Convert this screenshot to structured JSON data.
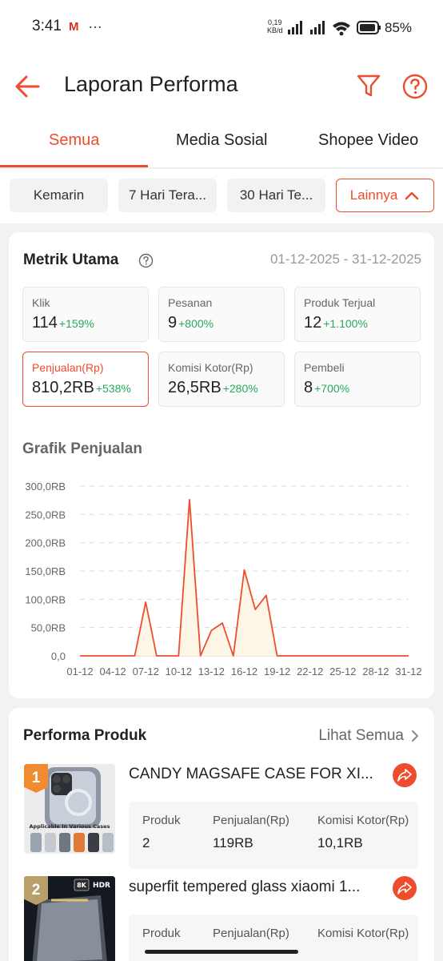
{
  "status_bar": {
    "time": "3:41",
    "gmail_icon": "gmail-icon",
    "more": "…",
    "speed_value": "0,19",
    "speed_unit": "KB/d",
    "battery_pct": "85%"
  },
  "header": {
    "title": "Laporan Performa",
    "back_icon": "back-arrow-icon",
    "filter_icon": "filter-icon",
    "help_icon": "help-icon",
    "accent": "#ee4d2d"
  },
  "tabs": [
    {
      "label": "Semua",
      "active": true
    },
    {
      "label": "Media Sosial",
      "active": false
    },
    {
      "label": "Shopee Video",
      "active": false
    }
  ],
  "date_chips": [
    {
      "label": "Kemarin"
    },
    {
      "label": "7 Hari Tera..."
    },
    {
      "label": "30 Hari Te..."
    },
    {
      "label": "Lainnya",
      "active": true
    }
  ],
  "metrics": {
    "title": "Metrik Utama",
    "date_range": "01-12-2025 - 31-12-2025",
    "items": [
      {
        "label": "Klik",
        "value": "114",
        "change": "+159%"
      },
      {
        "label": "Pesanan",
        "value": "9",
        "change": "+800%"
      },
      {
        "label": "Produk Terjual",
        "value": "12",
        "change": "+1.100%"
      },
      {
        "label": "Penjualan(Rp)",
        "value": "810,2RB",
        "change": "+538%",
        "active": true
      },
      {
        "label": "Komisi Kotor(Rp)",
        "value": "26,5RB",
        "change": "+280%"
      },
      {
        "label": "Pembeli",
        "value": "8",
        "change": "+700%"
      }
    ]
  },
  "chart_title": "Grafik Penjualan",
  "chart_data": {
    "type": "area",
    "title": "Grafik Penjualan",
    "xlabel": "",
    "ylabel": "",
    "x": [
      "01-12",
      "02-12",
      "03-12",
      "04-12",
      "05-12",
      "06-12",
      "07-12",
      "08-12",
      "09-12",
      "10-12",
      "11-12",
      "12-12",
      "13-12",
      "14-12",
      "15-12",
      "16-12",
      "17-12",
      "18-12",
      "19-12",
      "20-12",
      "21-12",
      "22-12",
      "23-12",
      "24-12",
      "25-12",
      "26-12",
      "27-12",
      "28-12",
      "29-12",
      "30-12",
      "31-12"
    ],
    "x_tick_labels": [
      "01-12",
      "04-12",
      "07-12",
      "10-12",
      "13-12",
      "16-12",
      "19-12",
      "22-12",
      "25-12",
      "28-12",
      "31-12"
    ],
    "y_tick_labels": [
      "0,0",
      "50,0RB",
      "100,0RB",
      "150,0RB",
      "200,0RB",
      "250,0RB",
      "300,0RB"
    ],
    "ylim": [
      0,
      300000
    ],
    "series": [
      {
        "values": [
          0,
          0,
          0,
          0,
          0,
          0,
          95000,
          0,
          0,
          0,
          276000,
          0,
          45000,
          58000,
          0,
          152000,
          82000,
          107000,
          0,
          0,
          0,
          0,
          0,
          0,
          0,
          0,
          0,
          0,
          0,
          0,
          0
        ]
      }
    ],
    "grid": "horizontal dashed",
    "line_color": "#ee4d2d",
    "fill_color": "#fdf6e6"
  },
  "products": {
    "title": "Performa Produk",
    "see_all": "Lihat Semua",
    "stat_labels": {
      "units": "Produk",
      "sales": "Penjualan(Rp)",
      "commission": "Komisi Kotor(Rp)"
    },
    "items": [
      {
        "rank": "1",
        "name": "CANDY MAGSAFE CASE FOR XI...",
        "image_caption": "Applicable In Various Cases",
        "units": "2",
        "sales": "119RB",
        "commission": "10,1RB",
        "rank_color": "#f08c2f"
      },
      {
        "rank": "2",
        "name": "superfit tempered glass xiaomi 1...",
        "image_caption_left": "8K",
        "image_caption_right": "HDR",
        "units": "",
        "sales": "",
        "commission": "",
        "rank_color": "#b9a06a"
      }
    ]
  }
}
